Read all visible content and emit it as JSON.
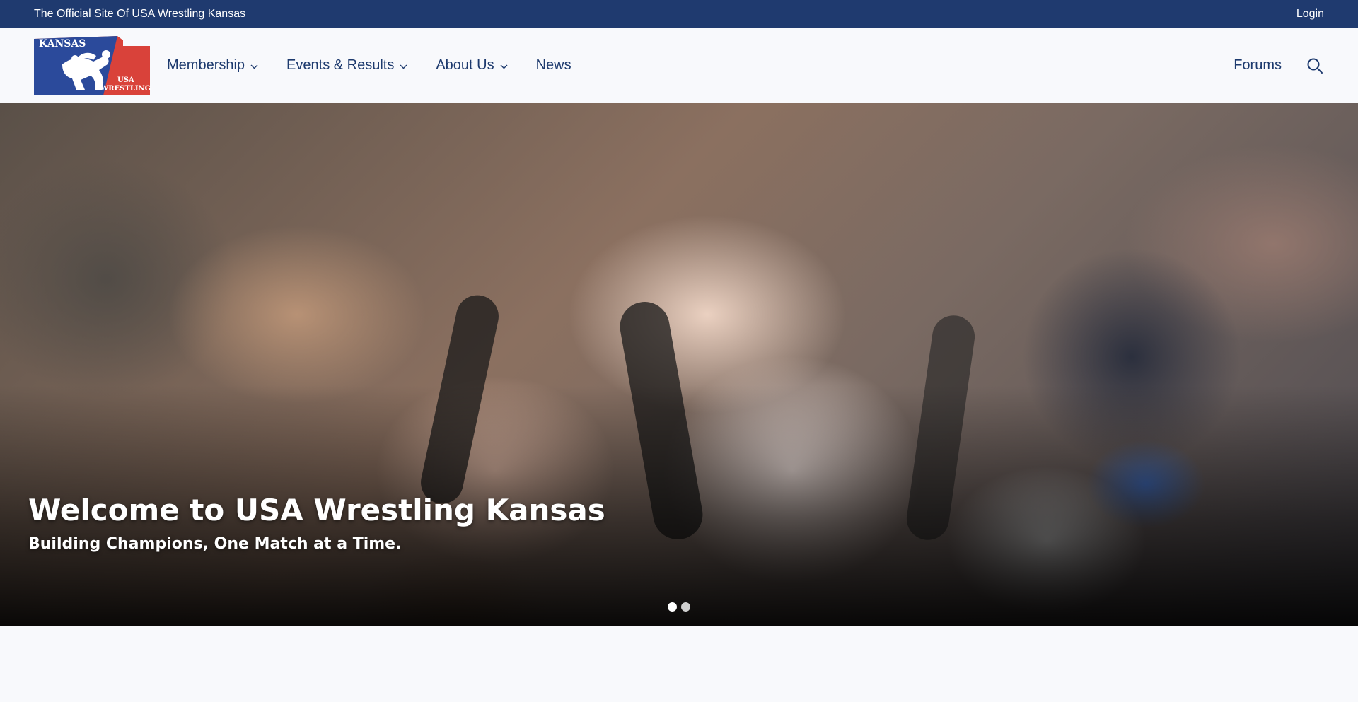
{
  "topbar": {
    "tagline": "The Official Site Of USA Wrestling Kansas",
    "login_label": "Login",
    "background": "#1f3a6f"
  },
  "logo": {
    "state_text": "KANSAS",
    "line1": "USA",
    "line2": "WRESTLING",
    "colors": {
      "blue": "#2b4a9b",
      "red": "#d9423a",
      "white": "#ffffff"
    }
  },
  "nav": {
    "items": [
      {
        "label": "Membership",
        "has_dropdown": true
      },
      {
        "label": "Events & Results",
        "has_dropdown": true
      },
      {
        "label": "About Us",
        "has_dropdown": true
      },
      {
        "label": "News",
        "has_dropdown": false
      }
    ],
    "forums_label": "Forums",
    "search_icon": "search-icon",
    "text_color": "#1d3a6e"
  },
  "hero": {
    "title": "Welcome to USA Wrestling Kansas",
    "subtitle": "Building Champions, One Match at a Time.",
    "slides_count": 2,
    "active_slide": 1
  }
}
